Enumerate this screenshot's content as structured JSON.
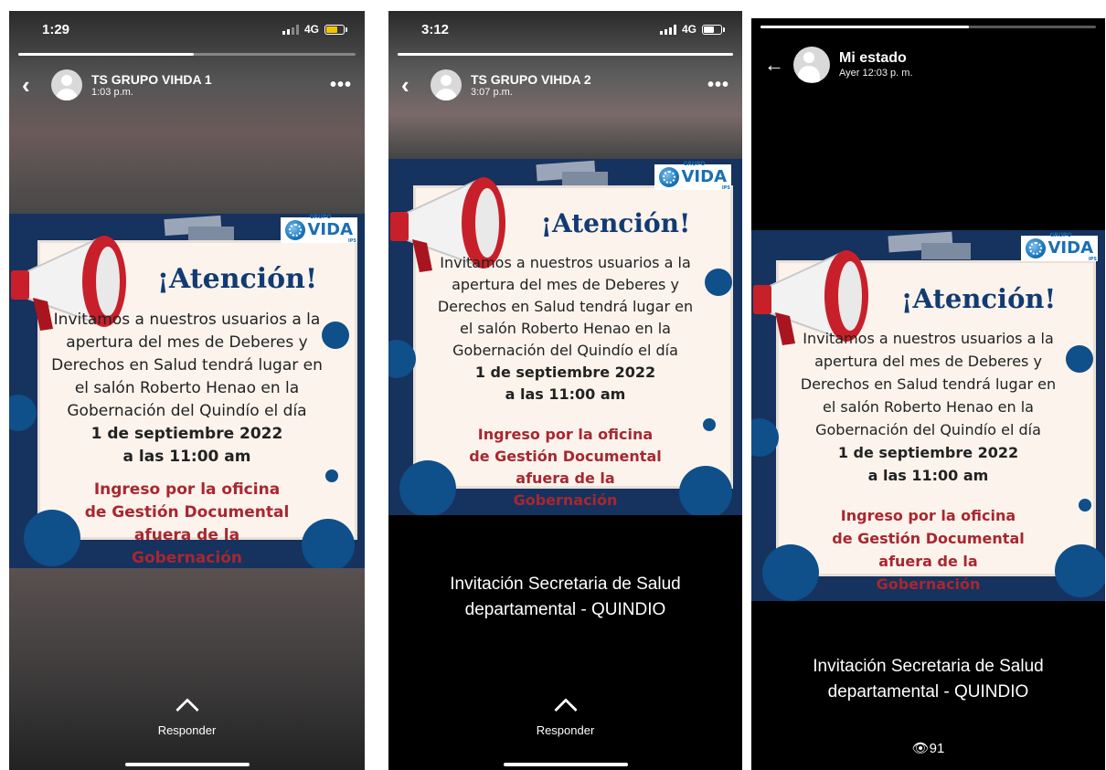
{
  "colors": {
    "accent_red": "#a82730",
    "navy": "#123b73",
    "poster_bg": "#16325e",
    "battery_low": "#f5c400"
  },
  "poster": {
    "logo_small": "GRUPO",
    "logo_main": "VIDA",
    "logo_ips": "IPS",
    "title": "¡Atención!",
    "line1": "Invitamos a nuestros usuarios a la",
    "line2": "apertura del mes de Deberes y",
    "line3": "Derechos en Salud tendrá lugar en",
    "line4": "el salón Roberto Henao en la",
    "line5": "Gobernación del Quindío el día",
    "date": "1 de septiembre 2022",
    "time": "a las 11:00 am",
    "red1": "Ingreso por la oficina",
    "red2": "de Gestión Documental",
    "red3": "afuera de la",
    "red4": "Gobernación"
  },
  "screens": [
    {
      "clock": "1:29",
      "network": "4G",
      "battery_level": 0.65,
      "story_progress": 0.52,
      "contact": "TS GRUPO VIHDA 1",
      "posted": "1:03 p.m.",
      "reply": "Responder"
    },
    {
      "clock": "3:12",
      "network": "4G",
      "battery_level": 0.6,
      "story_progress": 1.0,
      "contact": "TS GRUPO VIHDA 2",
      "posted": "3:07 p.m.",
      "caption1": "Invitación Secretaria de Salud",
      "caption2": "departamental - QUINDIO",
      "reply": "Responder"
    },
    {
      "story_progress": 0.62,
      "contact": "Mi estado",
      "posted": "Ayer 12:03 p. m.",
      "caption1": "Invitación Secretaria de Salud",
      "caption2": "departamental - QUINDIO",
      "views": "91"
    }
  ]
}
